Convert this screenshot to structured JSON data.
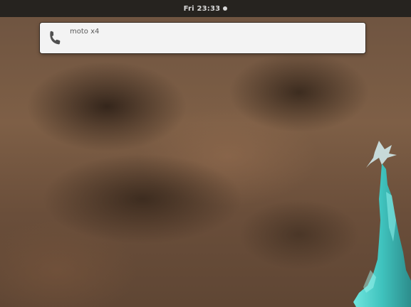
{
  "topbar": {
    "clock": "Fri 23:33",
    "status_indicator_icon": "dot-icon"
  },
  "notification": {
    "icon": "phone-icon",
    "text": "moto x4"
  },
  "colors": {
    "topbar_bg": "#26231f",
    "notification_bg": "#f3f3f3",
    "statue_glow": "#4fd6d0"
  }
}
